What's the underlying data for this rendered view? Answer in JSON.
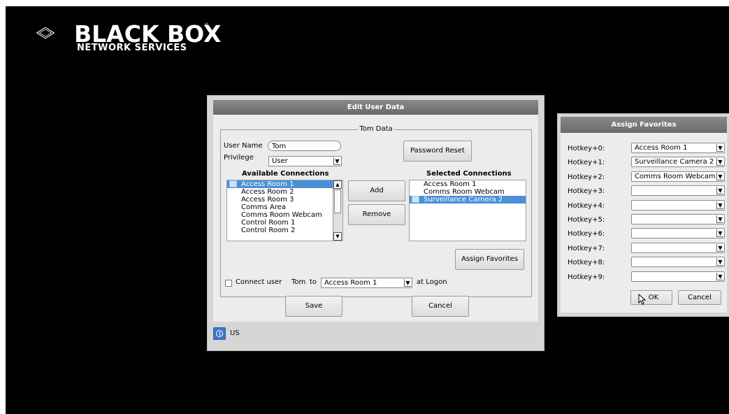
{
  "logo": {
    "brand": "BLACK BOX",
    "registered": "®",
    "subtitle": "NETWORK SERVICES"
  },
  "edit_dialog": {
    "title": "Edit User Data",
    "group_label": "Tom Data",
    "user_name_label": "User Name",
    "user_name_value": "Tom",
    "privilege_label": "Privilege",
    "privilege_value": "User",
    "password_reset_label": "Password Reset",
    "available_header": "Available Connections",
    "available_items": [
      "Access Room 1",
      "Access Room 2",
      "Access Room 3",
      "Comms Area",
      "Comms Room Webcam",
      "Control Room 1",
      "Control Room 2"
    ],
    "selected_header": "Selected Connections",
    "selected_items": [
      "Access Room 1",
      "Comms Room Webcam",
      "Surveillance Camera 2"
    ],
    "add_label": "Add",
    "remove_label": "Remove",
    "assign_favorites_label": "Assign Favorites",
    "connect_user_label": "Connect user",
    "connect_user_name": "Tom",
    "to_label": "to",
    "connect_target": "Access Room 1",
    "at_logon_label": "at Logon",
    "save_label": "Save",
    "cancel_label": "Cancel",
    "status_text": "US"
  },
  "fav_dialog": {
    "title": "Assign Favorites",
    "hotkeys": [
      {
        "label": "Hotkey+0:",
        "value": "Access Room 1"
      },
      {
        "label": "Hotkey+1:",
        "value": "Surveillance Camera 2"
      },
      {
        "label": "Hotkey+2:",
        "value": "Comms Room Webcam"
      },
      {
        "label": "Hotkey+3:",
        "value": ""
      },
      {
        "label": "Hotkey+4:",
        "value": ""
      },
      {
        "label": "Hotkey+5:",
        "value": ""
      },
      {
        "label": "Hotkey+6:",
        "value": ""
      },
      {
        "label": "Hotkey+7:",
        "value": ""
      },
      {
        "label": "Hotkey+8:",
        "value": ""
      },
      {
        "label": "Hotkey+9:",
        "value": ""
      }
    ],
    "ok_label": "OK",
    "cancel_label": "Cancel"
  },
  "colors": {
    "background": "#000000",
    "selection": "#4a90d9",
    "title_bar": "#7a7a7a"
  }
}
